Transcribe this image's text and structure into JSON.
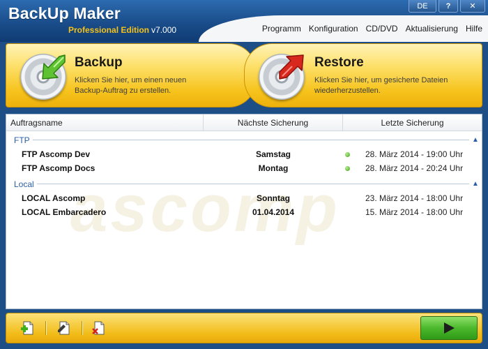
{
  "app": {
    "title": "BackUp Maker",
    "edition": "Professional Edition",
    "version": "v7.000"
  },
  "window_buttons": {
    "language": "DE",
    "help": "?",
    "close": "✕"
  },
  "menu": {
    "items": [
      "Programm",
      "Konfiguration",
      "CD/DVD",
      "Aktualisierung",
      "Hilfe"
    ]
  },
  "actions": {
    "backup": {
      "title": "Backup",
      "description": "Klicken Sie hier, um einen neuen Backup-Auftrag zu erstellen.",
      "icon": "disc-green-arrow-icon"
    },
    "restore": {
      "title": "Restore",
      "description": "Klicken Sie hier, um gesicherte Dateien wiederherzustellen.",
      "icon": "disc-red-arrow-icon"
    }
  },
  "list": {
    "columns": [
      "Auftragsname",
      "Nächste Sicherung",
      "Letzte Sicherung"
    ],
    "watermark": "ascomp",
    "groups": [
      {
        "label": "FTP",
        "toggle": "▲",
        "rows": [
          {
            "name": "FTP Ascomp Dev",
            "next": "Samstag",
            "last": "28. März 2014 - 19:00 Uhr",
            "status": "ok"
          },
          {
            "name": "FTP Ascomp Docs",
            "next": "Montag",
            "last": "28. März 2014 - 20:24 Uhr",
            "status": "ok"
          }
        ]
      },
      {
        "label": "Local",
        "toggle": "▲",
        "rows": [
          {
            "name": "LOCAL Ascomp",
            "next": "Sonntag",
            "last": "23. März 2014 - 18:00 Uhr",
            "status": "none"
          },
          {
            "name": "LOCAL Embarcadero",
            "next": "01.04.2014",
            "last": "15. März 2014 - 18:00 Uhr",
            "status": "none"
          }
        ]
      }
    ]
  },
  "toolbar": {
    "buttons": [
      "add-job-icon",
      "edit-job-icon",
      "delete-job-icon"
    ],
    "run_icon": "play-icon"
  },
  "colors": {
    "accent_blue": "#1d4f86",
    "accent_yellow": "#f6c31c",
    "status_green": "#3e9c1b",
    "group_blue": "#2a5fa8"
  }
}
